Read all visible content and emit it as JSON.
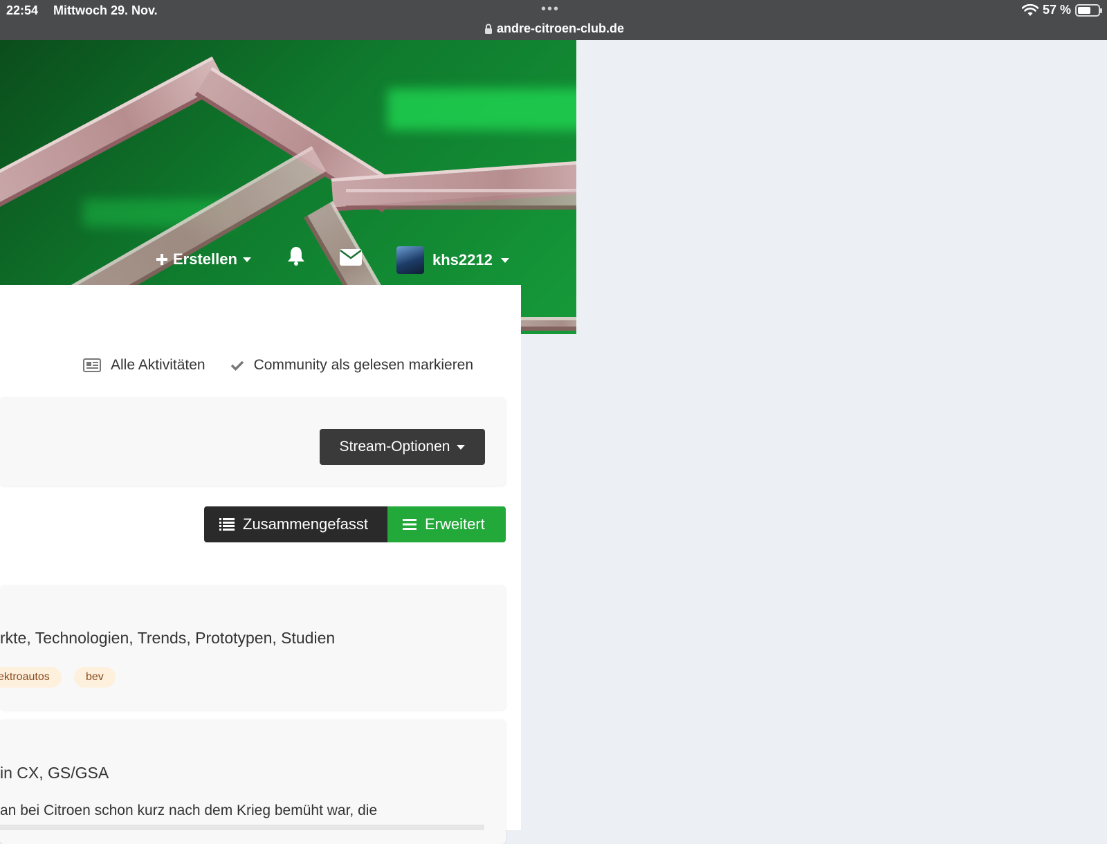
{
  "status_bar": {
    "time": "22:54",
    "date": "Mittwoch 29. Nov.",
    "dots": "•••",
    "url": "andre-citroen-club.de",
    "battery": "57 %",
    "battery_level": 0.57
  },
  "header_nav": {
    "create_label": "Erstellen",
    "username": "khs2212"
  },
  "page_links": {
    "all_activities": "Alle Aktivitäten",
    "mark_read": "Community als gelesen markieren"
  },
  "stream": {
    "options_label": "Stream-Optionen"
  },
  "view_toggle": {
    "compact_label": "Zusammengefasst",
    "expanded_label": "Erweitert",
    "active": "Erweitert"
  },
  "posts": [
    {
      "title_fragment": "rkte, Technologien, Trends, Prototypen, Studien",
      "tags": [
        "ektroautos",
        "bev"
      ]
    },
    {
      "title_fragment": "in CX, GS/GSA",
      "excerpt": "an bei Citroen schon kurz nach dem Krieg bemüht war, die"
    }
  ],
  "colors": {
    "accent_green": "#22a93a",
    "dark_button": "#3a3a3a",
    "tag_background": "#fdf0dd",
    "tag_text": "#8a4a1c"
  }
}
